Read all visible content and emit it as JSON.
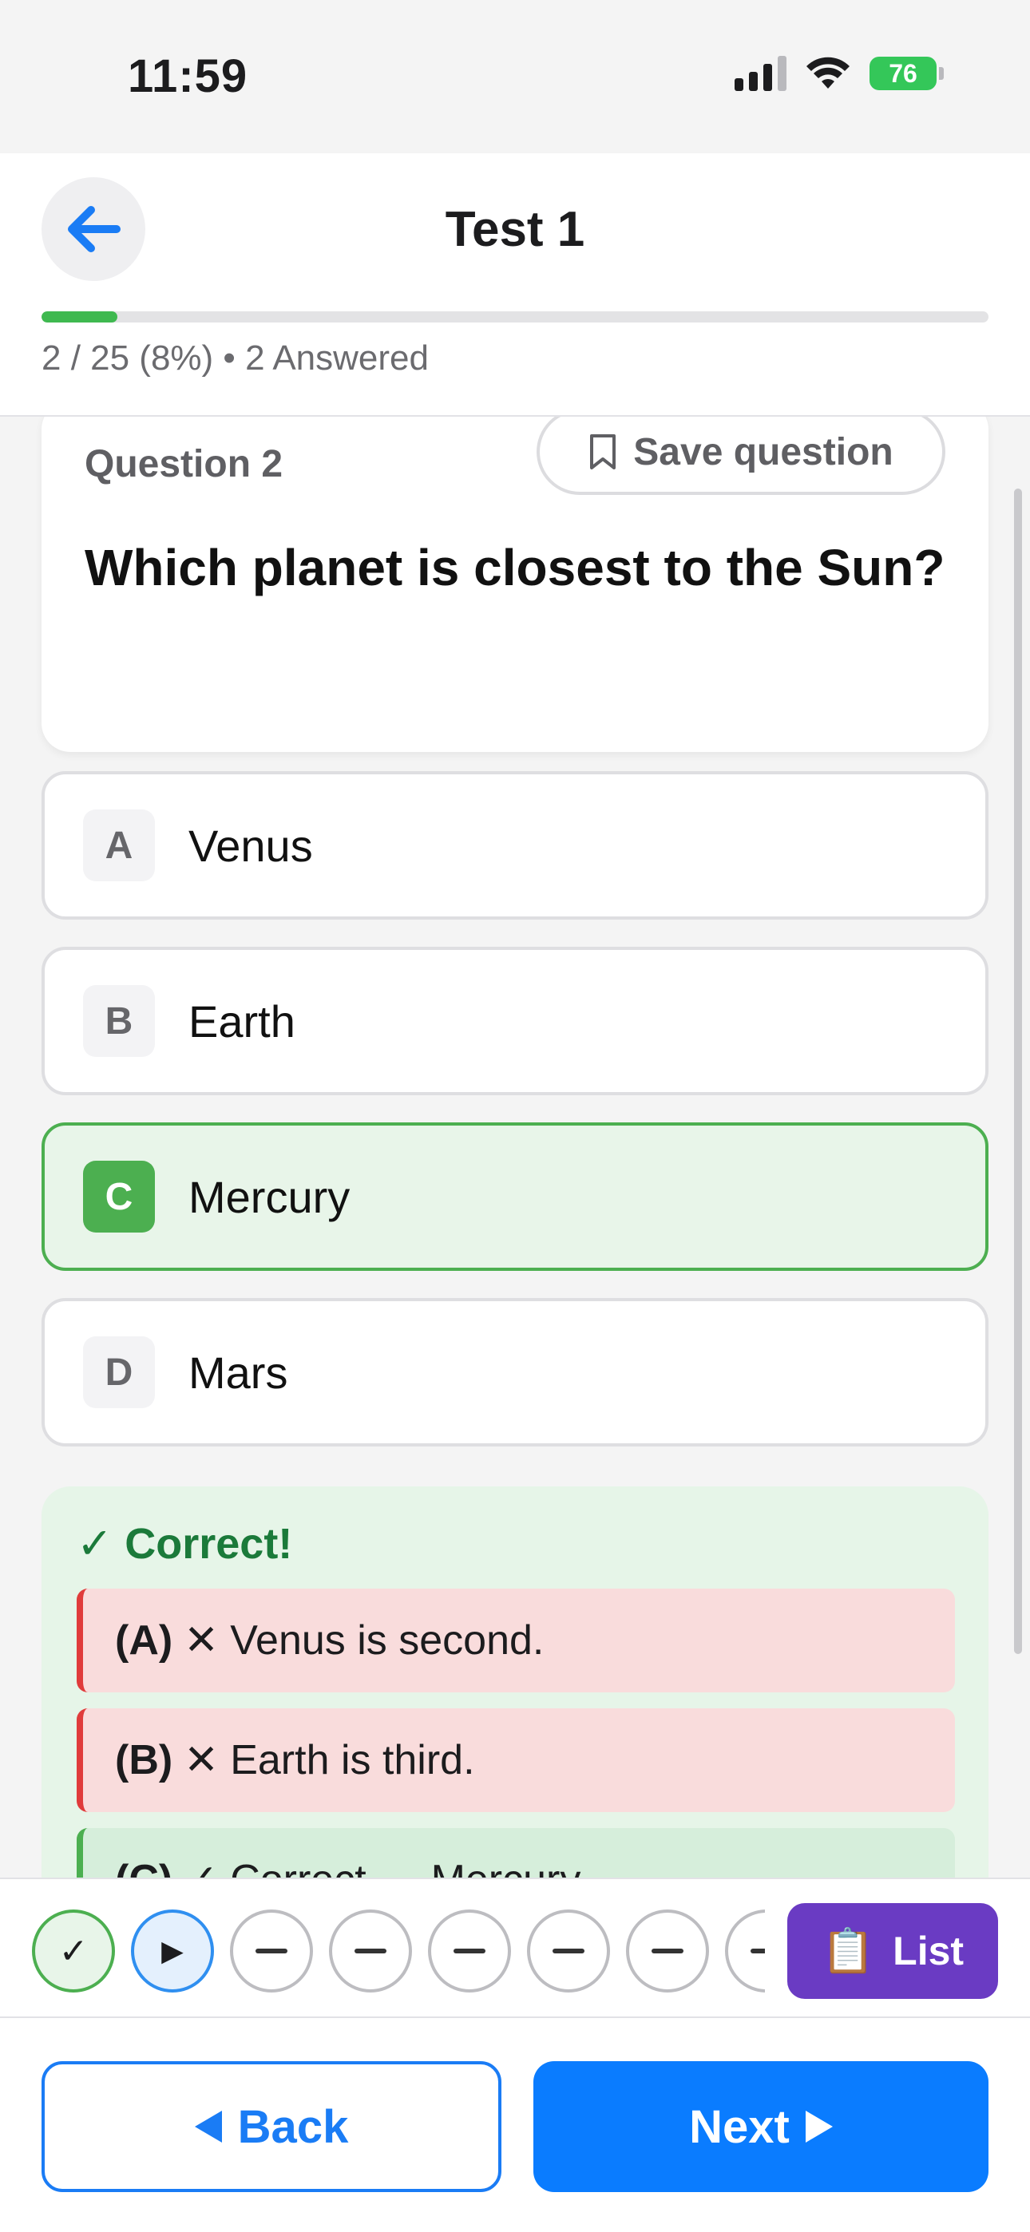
{
  "status_bar": {
    "time": "11:59",
    "battery": "76"
  },
  "header": {
    "title": "Test 1",
    "progress_fraction": 0.08,
    "progress_text": "2 / 25 (8%) • 2 Answered"
  },
  "question": {
    "number_label": "Question 2",
    "save_label": "Save question",
    "text": "Which planet is closest to the Sun?"
  },
  "options": [
    {
      "letter": "A",
      "text": "Venus",
      "selected": false
    },
    {
      "letter": "B",
      "text": "Earth",
      "selected": false
    },
    {
      "letter": "C",
      "text": "Mercury",
      "selected": true
    },
    {
      "letter": "D",
      "text": "Mars",
      "selected": false
    }
  ],
  "feedback": {
    "title": "✓ Correct!",
    "items": [
      {
        "tag": "(A)",
        "text": "✕ Venus is second.",
        "status": "wrong"
      },
      {
        "tag": "(B)",
        "text": "✕ Earth is third.",
        "status": "wrong"
      },
      {
        "tag": "(C)",
        "text": "✓ Correct — Mercury",
        "status": "right"
      }
    ]
  },
  "navigator": {
    "dots": [
      {
        "state": "done",
        "symbol": "✓"
      },
      {
        "state": "current",
        "symbol": "▶"
      },
      {
        "state": "empty"
      },
      {
        "state": "empty"
      },
      {
        "state": "empty"
      },
      {
        "state": "empty"
      },
      {
        "state": "empty"
      },
      {
        "state": "empty"
      }
    ],
    "list_label": "List",
    "list_icon": "📋"
  },
  "footer": {
    "back_label": "Back",
    "next_label": "Next"
  },
  "colors": {
    "accent_blue": "#0a7cff",
    "correct_green": "#4caf50",
    "wrong_red": "#e03b3b",
    "list_purple": "#6a3bc3"
  }
}
